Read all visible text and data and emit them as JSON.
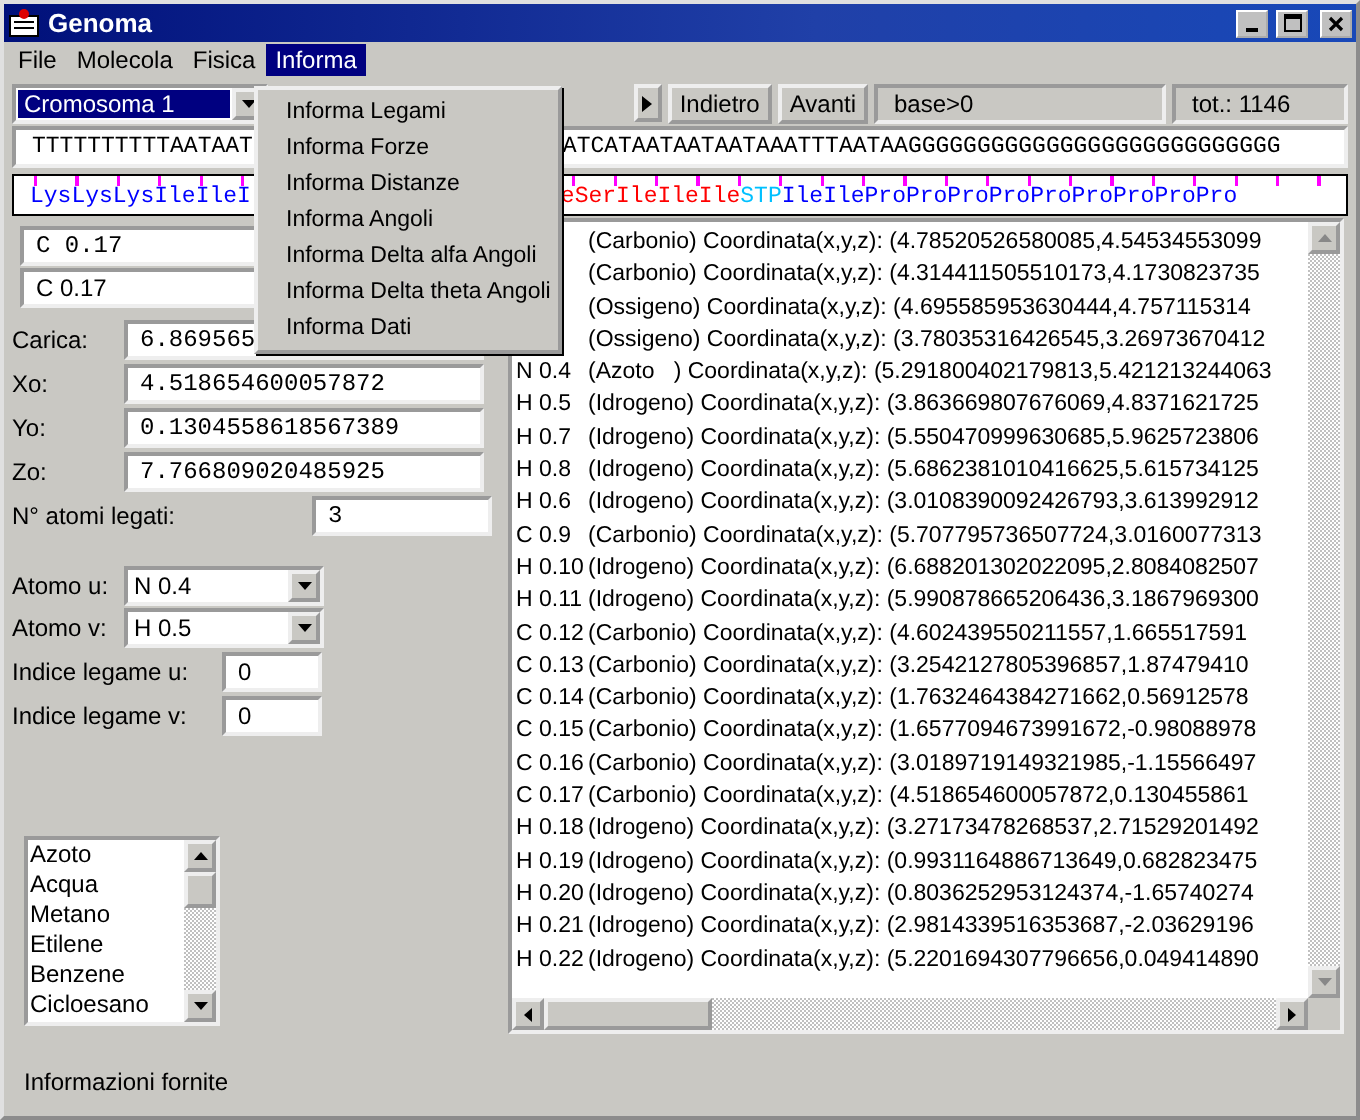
{
  "window": {
    "title": "Genoma"
  },
  "menu_bar": [
    {
      "label": "File",
      "selected": false
    },
    {
      "label": "Molecola",
      "selected": false
    },
    {
      "label": "Fisica",
      "selected": false
    },
    {
      "label": "Informa",
      "selected": true
    }
  ],
  "menu": {
    "items": [
      "Informa Legami",
      "Informa Forze",
      "Informa Distanze",
      "Informa Angoli",
      "Informa Delta alfa Angoli",
      "Informa Delta theta Angoli",
      "Informa Dati"
    ]
  },
  "toolbar": {
    "chromosome": "Cromosoma 1",
    "buttons": [
      "Indietro",
      "Avanti"
    ],
    "base": "base>0",
    "total": "tot.: 1146"
  },
  "sequence": [
    "TTTTTTTTTTAATAAT",
    "ATCATAATAATAATAAATTTAATAAGGGGGGGGGGGGGGGGGGGGGGGGGGG"
  ],
  "amino_acids": [
    [
      {
        "text": "LysLysLysIleIleI",
        "color": "#0000ff"
      }
    ],
    [
      {
        "text": "eSerIleIleIle",
        "color": "#ff0000"
      },
      {
        "text": "STP",
        "color": "#00c0ff"
      },
      {
        "text": "IleIleProProProProProProProProPro",
        "color": "#0000ff"
      }
    ]
  ],
  "atom_fields": [
    "C 0.17",
    "C 0.17"
  ],
  "properties": [
    {
      "label": "Carica:",
      "value": "6.869565"
    },
    {
      "label": "Xo:",
      "value": "4.518654600057872"
    },
    {
      "label": "Yo:",
      "value": "0.1304558618567389"
    },
    {
      "label": "Zo:",
      "value": "7.766809020485925"
    }
  ],
  "bonded_atoms": {
    "label": "N° atomi legati:",
    "value": "3"
  },
  "atom_selectors": [
    {
      "label": "Atomo u:",
      "value": "N 0.4"
    },
    {
      "label": "Atomo v:",
      "value": "H 0.5"
    }
  ],
  "bond_indices": [
    {
      "label": "Indice legame u:",
      "value": "0"
    },
    {
      "label": "Indice legame v:",
      "value": "0"
    }
  ],
  "molecules": [
    "Azoto",
    "Acqua",
    "Metano",
    "Etilene",
    "Benzene",
    "Cicloesano"
  ],
  "atoms": [
    {
      "text": "(Carbonio) Coordinata(x,y,z): (4.78520526580085,4.54534553099"
    },
    {
      "text": "(Carbonio) Coordinata(x,y,z): (4.314411505510173,4.1730823735"
    },
    {
      "text": "(Ossigeno) Coordinata(x,y,z): (4.695585953630444,4.757115314"
    },
    {
      "text": "(Ossigeno) Coordinata(x,y,z): (3.78035316426545,3.26973670412"
    },
    {
      "atom": "N 0.4",
      "text": "(Azoto   ) Coordinata(x,y,z): (5.291800402179813,5.421213244063"
    },
    {
      "atom": "H 0.5",
      "text": "(Idrogeno) Coordinata(x,y,z): (3.863669807676069,4.8371621725"
    },
    {
      "atom": "H 0.7",
      "text": "(Idrogeno) Coordinata(x,y,z): (5.550470999630685,5.9625723806"
    },
    {
      "atom": "H 0.8",
      "text": "(Idrogeno) Coordinata(x,y,z): (5.6862381010416625,5.615734125"
    },
    {
      "atom": "H 0.6",
      "text": "(Idrogeno) Coordinata(x,y,z): (3.0108390092426793,3.613992912"
    },
    {
      "atom": "C 0.9",
      "text": "(Carbonio) Coordinata(x,y,z): (5.707795736507724,3.0160077313"
    },
    {
      "atom": "H 0.10",
      "text": "(Idrogeno) Coordinata(x,y,z): (6.688201302022095,2.8084082507"
    },
    {
      "atom": "H 0.11",
      "text": "(Idrogeno) Coordinata(x,y,z): (5.990878665206436,3.1867969300"
    },
    {
      "atom": "C 0.12",
      "text": "(Carbonio) Coordinata(x,y,z): (4.602439550211557,1.665517591"
    },
    {
      "atom": "C 0.13",
      "text": "(Carbonio) Coordinata(x,y,z): (3.2542127805396857,1.87479410"
    },
    {
      "atom": "C 0.14",
      "text": "(Carbonio) Coordinata(x,y,z): (1.7632464384271662,0.56912578"
    },
    {
      "atom": "C 0.15",
      "text": "(Carbonio) Coordinata(x,y,z): (1.6577094673991672,-0.98088978"
    },
    {
      "atom": "C 0.16",
      "text": "(Carbonio) Coordinata(x,y,z): (3.0189719149321985,-1.15566497"
    },
    {
      "atom": "C 0.17",
      "text": "(Carbonio) Coordinata(x,y,z): (4.518654600057872,0.130455861"
    },
    {
      "atom": "H 0.18",
      "text": "(Idrogeno) Coordinata(x,y,z): (3.27173478268537,2.71529201492"
    },
    {
      "atom": "H 0.19",
      "text": "(Idrogeno) Coordinata(x,y,z): (0.9931164886713649,0.682823475"
    },
    {
      "atom": "H 0.20",
      "text": "(Idrogeno) Coordinata(x,y,z): (0.8036252953124374,-1.65740274"
    },
    {
      "atom": "H 0.21",
      "text": "(Idrogeno) Coordinata(x,y,z): (2.9814339516353687,-2.03629196"
    },
    {
      "atom": "H 0.22",
      "text": "(Idrogeno) Coordinata(x,y,z): (5.2201694307796656,0.049414890"
    }
  ],
  "status_bar": "Informazioni fornite"
}
